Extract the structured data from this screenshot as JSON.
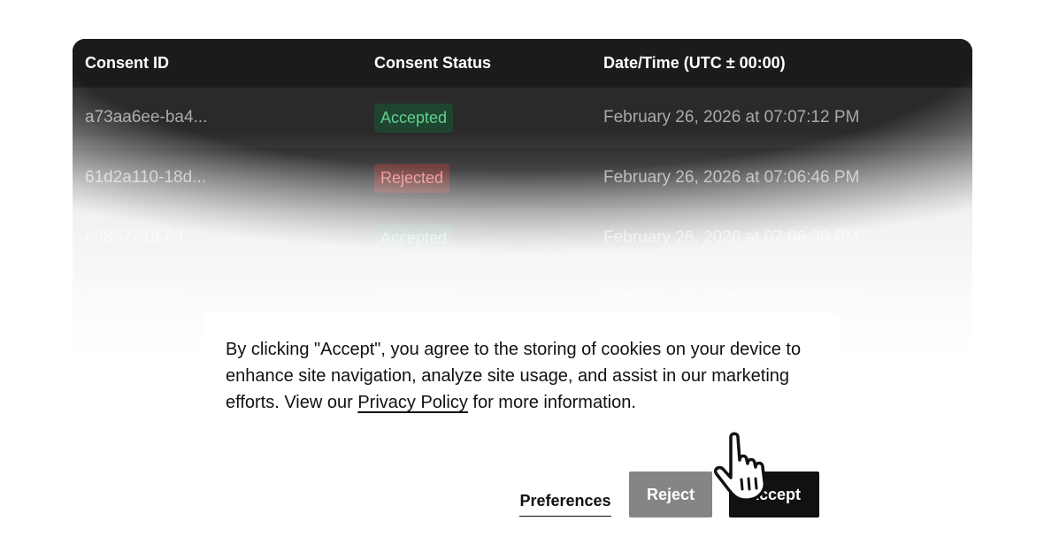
{
  "table": {
    "headers": {
      "id": "Consent ID",
      "status": "Consent Status",
      "datetime": "Date/Time (UTC ± 00:00)"
    },
    "rows": [
      {
        "id": "a73aa6ee-ba4...",
        "status": "Accepted",
        "datetime": "February 26, 2026 at 07:07:12 PM"
      },
      {
        "id": "61d2a110-18d...",
        "status": "Rejected",
        "datetime": "February 26, 2026 at 07:06:46 PM"
      },
      {
        "id": "e6857218-fcf...",
        "status": "Accepted",
        "datetime": "February 26, 2026 at 07:06:36 PM"
      },
      {
        "id": "e6857218-fcf...",
        "status": "Accepted",
        "datetime": "February 26, 2026 at 07:06:36 PM"
      }
    ],
    "colors": {
      "accepted": "#5fd08e",
      "rejected": "#f07b78"
    }
  },
  "cookie_banner": {
    "text_before_link": "By clicking \"Accept\", you agree to the storing of cookies on your device to enhance site navigation, analyze site usage, and assist in our marketing efforts. View our ",
    "link_label": "Privacy Policy",
    "text_after_link": " for more information.",
    "preferences_label": "Preferences",
    "reject_label": "Reject",
    "accept_label": "Accept"
  },
  "cursor": {
    "icon": "hand-pointer-icon"
  }
}
